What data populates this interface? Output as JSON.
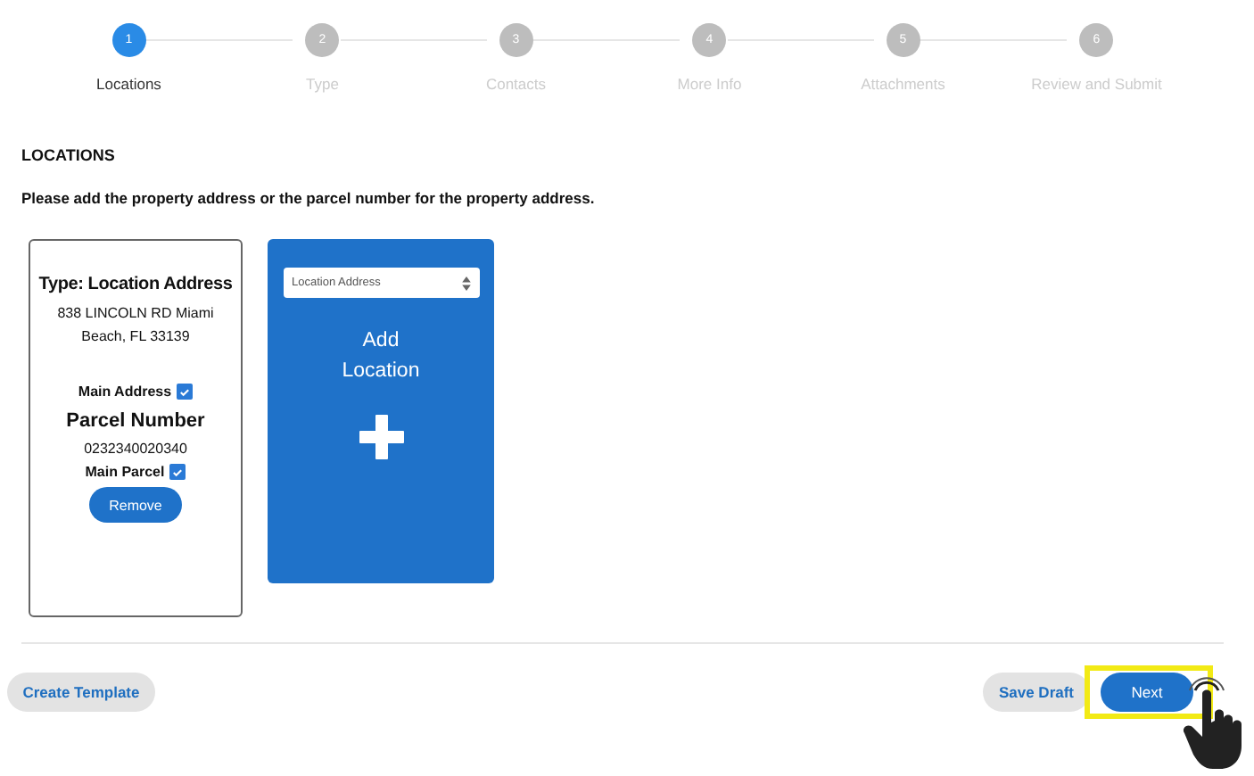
{
  "steps": [
    {
      "number": "1",
      "label": "Locations",
      "selected": true
    },
    {
      "number": "2",
      "label": "Type",
      "selected": false
    },
    {
      "number": "3",
      "label": "Contacts",
      "selected": false
    },
    {
      "number": "4",
      "label": "More Info",
      "selected": false
    },
    {
      "number": "5",
      "label": "Attachments",
      "selected": false
    },
    {
      "number": "6",
      "label": "Review and Submit",
      "selected": false
    }
  ],
  "section": {
    "title": "LOCATIONS",
    "instruction": "Please add the property address or the parcel number for the property address."
  },
  "location_card": {
    "type_title": "Type: Location Address",
    "address": "838 LINCOLN RD Miami Beach, FL 33139",
    "main_address": {
      "label": "Main Address",
      "checked": true
    },
    "parcel_title": "Parcel Number",
    "parcel_number": "0232340020340",
    "main_parcel": {
      "label": "Main Parcel",
      "checked": true
    },
    "remove_button": "Remove"
  },
  "add_card": {
    "type_select": "Location Address",
    "label": "Add Location"
  },
  "footer": {
    "left_button": "Create Template",
    "buttons": [
      {
        "label": "Save Draft",
        "kind": "secondary",
        "highlighted": false
      },
      {
        "label": "Next",
        "kind": "primary",
        "highlighted": true
      }
    ]
  }
}
